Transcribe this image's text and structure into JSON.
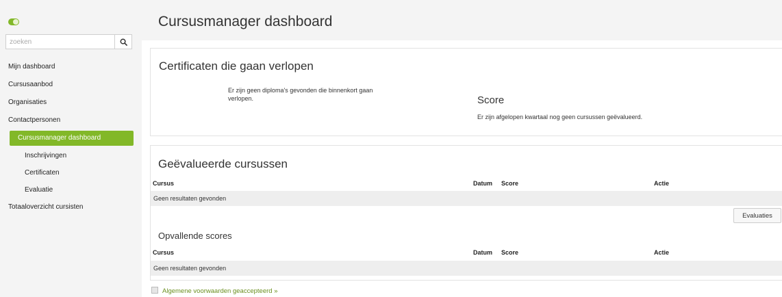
{
  "colors": {
    "accent": "#82b828",
    "sidebar_bg": "#f4f4f4",
    "row_bg": "#eeeeee"
  },
  "search": {
    "placeholder": "zoeken",
    "icon": "search-icon"
  },
  "sidebar": {
    "items": [
      {
        "label": "Mijn dashboard"
      },
      {
        "label": "Cursusaanbod"
      },
      {
        "label": "Organisaties"
      },
      {
        "label": "Contactpersonen"
      },
      {
        "label": "Cursusmanager dashboard",
        "active": true
      },
      {
        "label": "Inschrijvingen",
        "sub": true
      },
      {
        "label": "Certificaten",
        "sub": true
      },
      {
        "label": "Evaluatie",
        "sub": true
      },
      {
        "label": "Totaaloverzicht cursisten"
      }
    ]
  },
  "header": {
    "title": "Cursusmanager dashboard"
  },
  "certificates": {
    "title": "Certificaten die gaan verlopen",
    "message": "Er zijn geen diploma's gevonden die binnenkort gaan verlopen."
  },
  "score": {
    "title": "Score",
    "message": "Er zijn afgelopen kwartaal nog geen cursussen geëvalueerd."
  },
  "evaluated": {
    "title": "Geëvalueerde cursussen",
    "columns": [
      "Cursus",
      "Datum",
      "Score",
      "Actie"
    ],
    "empty": "Geen resultaten gevonden",
    "button": "Evaluaties"
  },
  "notable": {
    "title": "Opvallende scores",
    "columns": [
      "Cursus",
      "Datum",
      "Score",
      "Actie"
    ],
    "empty": "Geen resultaten gevonden"
  },
  "footer": {
    "terms": "Algemene voorwaarden geaccepteerd  »"
  }
}
